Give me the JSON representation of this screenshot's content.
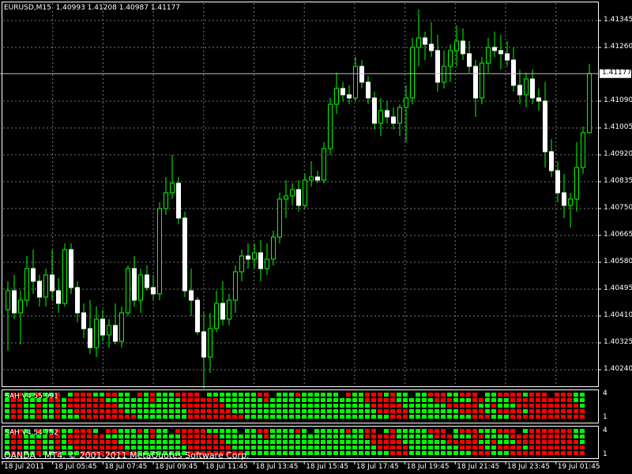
{
  "chart_header": {
    "symbol": "EURUSD,M15",
    "ohlc": "1.40993 1.41208 1.40987 1.41177"
  },
  "price_axis": {
    "labels": [
      "1.41345",
      "1.41260",
      "1.41177",
      "1.41090",
      "1.41005",
      "1.40920",
      "1.40835",
      "1.40750",
      "1.40665",
      "1.40580",
      "1.40495",
      "1.40410",
      "1.40325",
      "1.40240"
    ],
    "current_price": "1.41177"
  },
  "time_axis": {
    "labels": [
      "18 Jul 2011",
      "18 Jul 05:45",
      "18 Jul 07:45",
      "18 Jul 09:45",
      "18 Jul 11:45",
      "18 Jul 13:45",
      "18 Jul 15:45",
      "18 Jul 17:45",
      "18 Jul 19:45",
      "18 Jul 21:45",
      "18 Jul 23:45",
      "19 Jul 01:45"
    ]
  },
  "indicators": [
    {
      "label": "SAH V4.55 991",
      "scale_max": "4",
      "scale_min": "1"
    },
    {
      "label": "SAH V4.54 752",
      "scale_max": "4",
      "scale_min": "1"
    }
  ],
  "footer": {
    "text": "OANDA - MT4, © 2001-2011 MetaQuotes Software Corp."
  },
  "colors": {
    "background": "#000000",
    "axis": "#ffffff",
    "grid": "#777777",
    "bull_wick": "#00ff00",
    "bull_body": "#000000",
    "bear_body": "#ffffff",
    "signal_up": "#00ff00",
    "signal_down": "#ff0000"
  },
  "chart_data": {
    "type": "candlestick",
    "symbol": "EURUSD,M15",
    "ylim": [
      1.4019,
      1.414
    ],
    "candles": [
      {
        "o": 1.4043,
        "h": 1.4052,
        "l": 1.403,
        "c": 1.4049
      },
      {
        "o": 1.4049,
        "h": 1.4054,
        "l": 1.404,
        "c": 1.4042
      },
      {
        "o": 1.4042,
        "h": 1.4049,
        "l": 1.4032,
        "c": 1.4046
      },
      {
        "o": 1.4046,
        "h": 1.406,
        "l": 1.4044,
        "c": 1.4056
      },
      {
        "o": 1.4056,
        "h": 1.4062,
        "l": 1.4048,
        "c": 1.4052
      },
      {
        "o": 1.4052,
        "h": 1.4054,
        "l": 1.4044,
        "c": 1.4047
      },
      {
        "o": 1.4047,
        "h": 1.4056,
        "l": 1.4044,
        "c": 1.4054
      },
      {
        "o": 1.4054,
        "h": 1.4062,
        "l": 1.4046,
        "c": 1.4049
      },
      {
        "o": 1.4049,
        "h": 1.4053,
        "l": 1.4042,
        "c": 1.4045
      },
      {
        "o": 1.4045,
        "h": 1.4064,
        "l": 1.4044,
        "c": 1.4062
      },
      {
        "o": 1.4062,
        "h": 1.4064,
        "l": 1.4048,
        "c": 1.405
      },
      {
        "o": 1.405,
        "h": 1.4052,
        "l": 1.4039,
        "c": 1.4042
      },
      {
        "o": 1.4042,
        "h": 1.4045,
        "l": 1.4034,
        "c": 1.4037
      },
      {
        "o": 1.4037,
        "h": 1.4046,
        "l": 1.4029,
        "c": 1.4031
      },
      {
        "o": 1.4031,
        "h": 1.4044,
        "l": 1.4028,
        "c": 1.404
      },
      {
        "o": 1.404,
        "h": 1.4043,
        "l": 1.4033,
        "c": 1.4035
      },
      {
        "o": 1.4035,
        "h": 1.404,
        "l": 1.4031,
        "c": 1.4038
      },
      {
        "o": 1.4038,
        "h": 1.4045,
        "l": 1.4032,
        "c": 1.4033
      },
      {
        "o": 1.4033,
        "h": 1.4044,
        "l": 1.4031,
        "c": 1.4042
      },
      {
        "o": 1.4042,
        "h": 1.4057,
        "l": 1.4041,
        "c": 1.4056
      },
      {
        "o": 1.4056,
        "h": 1.406,
        "l": 1.4044,
        "c": 1.4046
      },
      {
        "o": 1.4046,
        "h": 1.4056,
        "l": 1.4042,
        "c": 1.4054
      },
      {
        "o": 1.4054,
        "h": 1.4057,
        "l": 1.4049,
        "c": 1.405
      },
      {
        "o": 1.405,
        "h": 1.4054,
        "l": 1.4046,
        "c": 1.4048
      },
      {
        "o": 1.4048,
        "h": 1.4077,
        "l": 1.4046,
        "c": 1.4075
      },
      {
        "o": 1.4075,
        "h": 1.4085,
        "l": 1.4073,
        "c": 1.408
      },
      {
        "o": 1.408,
        "h": 1.4092,
        "l": 1.4078,
        "c": 1.4083
      },
      {
        "o": 1.4083,
        "h": 1.4085,
        "l": 1.407,
        "c": 1.4072
      },
      {
        "o": 1.4072,
        "h": 1.4074,
        "l": 1.4047,
        "c": 1.4049
      },
      {
        "o": 1.4049,
        "h": 1.4056,
        "l": 1.4041,
        "c": 1.4046
      },
      {
        "o": 1.4046,
        "h": 1.4047,
        "l": 1.4035,
        "c": 1.4036
      },
      {
        "o": 1.4036,
        "h": 1.4042,
        "l": 1.4018,
        "c": 1.4028
      },
      {
        "o": 1.4028,
        "h": 1.4042,
        "l": 1.4023,
        "c": 1.4037
      },
      {
        "o": 1.4037,
        "h": 1.4049,
        "l": 1.4036,
        "c": 1.4045
      },
      {
        "o": 1.4045,
        "h": 1.4052,
        "l": 1.4038,
        "c": 1.404
      },
      {
        "o": 1.404,
        "h": 1.4048,
        "l": 1.4038,
        "c": 1.4046
      },
      {
        "o": 1.4046,
        "h": 1.4057,
        "l": 1.4042,
        "c": 1.4055
      },
      {
        "o": 1.4055,
        "h": 1.4062,
        "l": 1.4052,
        "c": 1.406
      },
      {
        "o": 1.406,
        "h": 1.4064,
        "l": 1.4056,
        "c": 1.4059
      },
      {
        "o": 1.4059,
        "h": 1.4064,
        "l": 1.4056,
        "c": 1.4061
      },
      {
        "o": 1.4061,
        "h": 1.4065,
        "l": 1.4052,
        "c": 1.4056
      },
      {
        "o": 1.4056,
        "h": 1.4064,
        "l": 1.4054,
        "c": 1.4059
      },
      {
        "o": 1.4059,
        "h": 1.4068,
        "l": 1.4057,
        "c": 1.4066
      },
      {
        "o": 1.4066,
        "h": 1.408,
        "l": 1.4064,
        "c": 1.4078
      },
      {
        "o": 1.4078,
        "h": 1.4084,
        "l": 1.4072,
        "c": 1.4079
      },
      {
        "o": 1.4079,
        "h": 1.4083,
        "l": 1.4076,
        "c": 1.4081
      },
      {
        "o": 1.4081,
        "h": 1.4084,
        "l": 1.4074,
        "c": 1.4076
      },
      {
        "o": 1.4076,
        "h": 1.4086,
        "l": 1.4075,
        "c": 1.4084
      },
      {
        "o": 1.4084,
        "h": 1.409,
        "l": 1.4082,
        "c": 1.4085
      },
      {
        "o": 1.4085,
        "h": 1.4087,
        "l": 1.4083,
        "c": 1.4084
      },
      {
        "o": 1.4084,
        "h": 1.4096,
        "l": 1.4083,
        "c": 1.4094
      },
      {
        "o": 1.4094,
        "h": 1.411,
        "l": 1.4092,
        "c": 1.4108
      },
      {
        "o": 1.4108,
        "h": 1.4118,
        "l": 1.4105,
        "c": 1.4113
      },
      {
        "o": 1.4113,
        "h": 1.4115,
        "l": 1.4109,
        "c": 1.4111
      },
      {
        "o": 1.4111,
        "h": 1.4114,
        "l": 1.4108,
        "c": 1.411
      },
      {
        "o": 1.411,
        "h": 1.4123,
        "l": 1.4109,
        "c": 1.412
      },
      {
        "o": 1.412,
        "h": 1.4122,
        "l": 1.4113,
        "c": 1.4115
      },
      {
        "o": 1.4115,
        "h": 1.4117,
        "l": 1.4108,
        "c": 1.411
      },
      {
        "o": 1.411,
        "h": 1.4112,
        "l": 1.41,
        "c": 1.4102
      },
      {
        "o": 1.4102,
        "h": 1.411,
        "l": 1.4098,
        "c": 1.4106
      },
      {
        "o": 1.4106,
        "h": 1.4109,
        "l": 1.4102,
        "c": 1.4104
      },
      {
        "o": 1.4104,
        "h": 1.4107,
        "l": 1.41,
        "c": 1.4102
      },
      {
        "o": 1.4102,
        "h": 1.4108,
        "l": 1.4098,
        "c": 1.4107
      },
      {
        "o": 1.4107,
        "h": 1.4114,
        "l": 1.4096,
        "c": 1.411
      },
      {
        "o": 1.411,
        "h": 1.4129,
        "l": 1.4108,
        "c": 1.4126
      },
      {
        "o": 1.4126,
        "h": 1.4138,
        "l": 1.412,
        "c": 1.4129
      },
      {
        "o": 1.4129,
        "h": 1.4131,
        "l": 1.4122,
        "c": 1.4127
      },
      {
        "o": 1.4127,
        "h": 1.4134,
        "l": 1.4123,
        "c": 1.4125
      },
      {
        "o": 1.4125,
        "h": 1.413,
        "l": 1.4112,
        "c": 1.4115
      },
      {
        "o": 1.4115,
        "h": 1.4125,
        "l": 1.4113,
        "c": 1.412
      },
      {
        "o": 1.412,
        "h": 1.4127,
        "l": 1.4115,
        "c": 1.4125
      },
      {
        "o": 1.4125,
        "h": 1.4133,
        "l": 1.412,
        "c": 1.4128
      },
      {
        "o": 1.4128,
        "h": 1.4132,
        "l": 1.4122,
        "c": 1.4124
      },
      {
        "o": 1.4124,
        "h": 1.4128,
        "l": 1.4118,
        "c": 1.412
      },
      {
        "o": 1.412,
        "h": 1.4122,
        "l": 1.4104,
        "c": 1.411
      },
      {
        "o": 1.411,
        "h": 1.4123,
        "l": 1.4108,
        "c": 1.4121
      },
      {
        "o": 1.4121,
        "h": 1.4129,
        "l": 1.4118,
        "c": 1.4126
      },
      {
        "o": 1.4126,
        "h": 1.4131,
        "l": 1.4123,
        "c": 1.4125
      },
      {
        "o": 1.4125,
        "h": 1.413,
        "l": 1.4119,
        "c": 1.4124
      },
      {
        "o": 1.4124,
        "h": 1.4128,
        "l": 1.412,
        "c": 1.4122
      },
      {
        "o": 1.4122,
        "h": 1.4126,
        "l": 1.4112,
        "c": 1.4114
      },
      {
        "o": 1.4114,
        "h": 1.4119,
        "l": 1.4108,
        "c": 1.4111
      },
      {
        "o": 1.4111,
        "h": 1.4118,
        "l": 1.4107,
        "c": 1.4116
      },
      {
        "o": 1.4116,
        "h": 1.4119,
        "l": 1.4108,
        "c": 1.411
      },
      {
        "o": 1.411,
        "h": 1.4113,
        "l": 1.4106,
        "c": 1.4109
      },
      {
        "o": 1.4109,
        "h": 1.4115,
        "l": 1.4088,
        "c": 1.4093
      },
      {
        "o": 1.4093,
        "h": 1.4097,
        "l": 1.4085,
        "c": 1.4087
      },
      {
        "o": 1.4087,
        "h": 1.409,
        "l": 1.4077,
        "c": 1.408
      },
      {
        "o": 1.408,
        "h": 1.4086,
        "l": 1.4072,
        "c": 1.4076
      },
      {
        "o": 1.4076,
        "h": 1.408,
        "l": 1.4069,
        "c": 1.4078
      },
      {
        "o": 1.4078,
        "h": 1.4096,
        "l": 1.4074,
        "c": 1.4088
      },
      {
        "o": 1.4088,
        "h": 1.4101,
        "l": 1.4086,
        "c": 1.4099
      },
      {
        "o": 1.4099,
        "h": 1.41208,
        "l": 1.40987,
        "c": 1.41177
      }
    ]
  }
}
